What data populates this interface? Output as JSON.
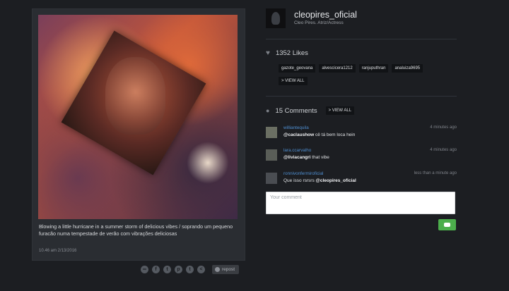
{
  "post": {
    "caption": "Blowing a little hurricane in a summer storm of delicious vibes / soprando um pequeno furacão numa tempestade de verão com vibrações deliciosas",
    "time": "10.46 am 2/13/2016",
    "repost_label": "repost"
  },
  "profile": {
    "username": "cleopires_oficial",
    "fullname": "Cleo Pires. Atriz/Actress"
  },
  "likes": {
    "count_label": "1352 Likes",
    "users": [
      "gazote_geovana",
      "alvescicera1212",
      "ranjuputhran",
      "analuiza9695"
    ],
    "view_all": "> VIEW ALL"
  },
  "comments": {
    "count_label": "15 Comments",
    "view_all": "> VIEW ALL",
    "items": [
      {
        "user": "williantequila",
        "mention": "@caclaushow",
        "text": " cê tá bem loca hein",
        "time": "4 minutes ago"
      },
      {
        "user": "lara.ccarvalho",
        "mention": "@liviacangri",
        "text": " that vibe",
        "time": "4 minutes ago"
      },
      {
        "user": "ronnivonfermiroficial",
        "text": "Que isso rsrsrs ",
        "mention": "@cleopires_oficial",
        "time": "less than a minute ago"
      }
    ],
    "input_placeholder": "Your comment"
  },
  "share_icons": [
    "link-icon",
    "facebook-icon",
    "twitter-icon",
    "pinterest-icon",
    "tumblr-icon",
    "share-icon"
  ]
}
